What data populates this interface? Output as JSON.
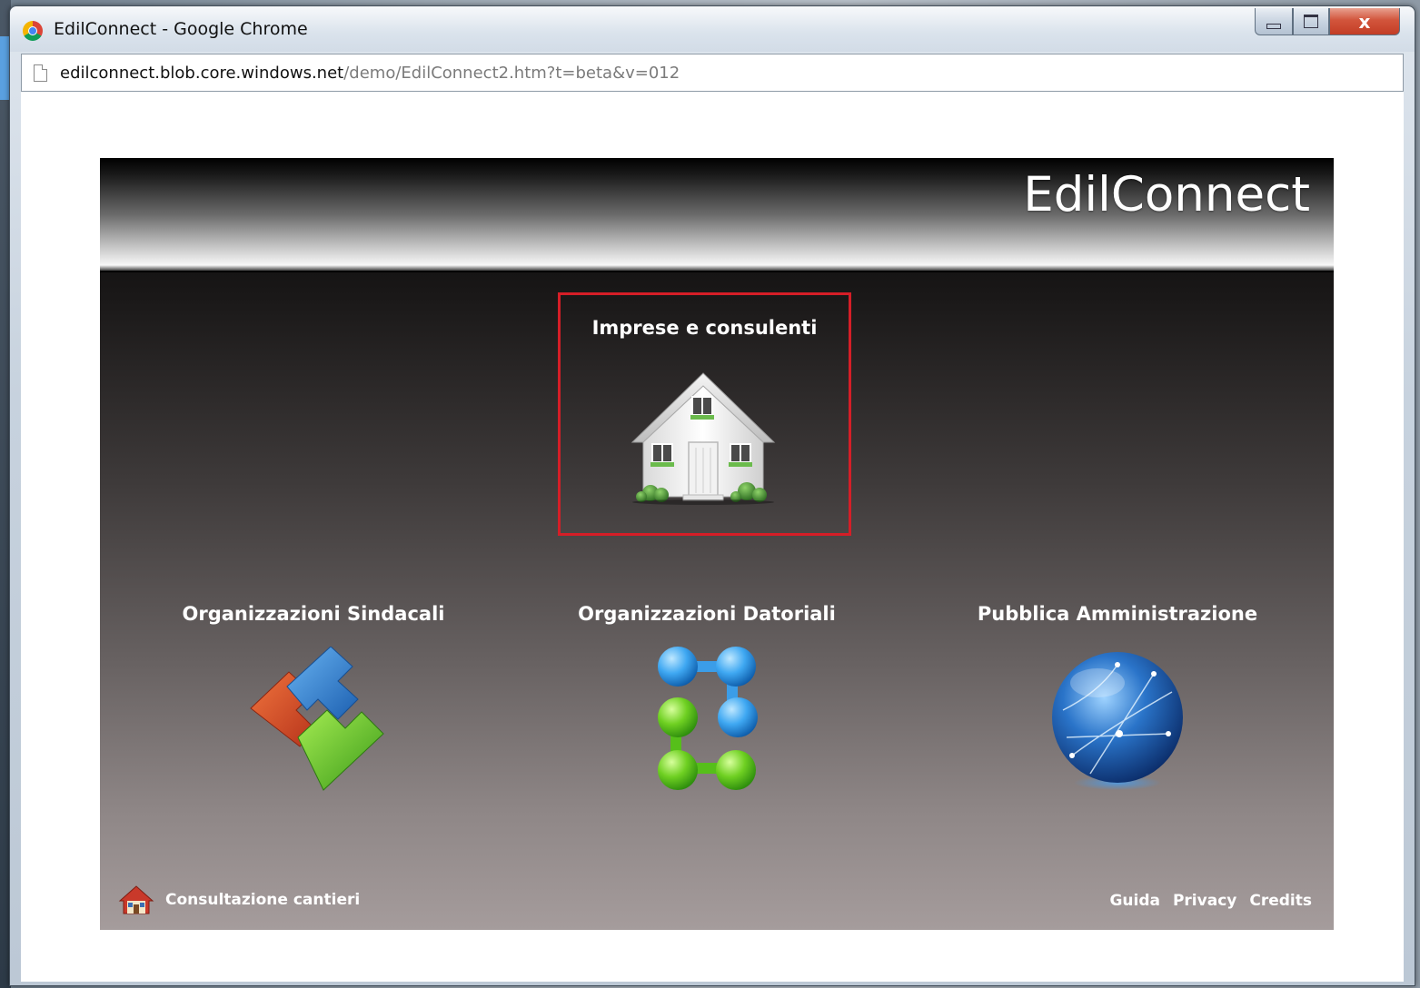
{
  "window": {
    "title": "EdilConnect - Google Chrome",
    "close_glyph": "x"
  },
  "address_bar": {
    "host": "edilconnect.blob.core.windows.net",
    "path": "/demo/EdilConnect2.htm?t=beta&v=012"
  },
  "app": {
    "title": "EdilConnect",
    "tiles": [
      {
        "label": "Imprese e consulenti",
        "icon": "house-icon",
        "selected": true
      },
      {
        "label": "Organizzazioni Sindacali",
        "icon": "puzzle-blocks-icon"
      },
      {
        "label": "Organizzazioni Datoriali",
        "icon": "molecule-icon"
      },
      {
        "label": "Pubblica Amministrazione",
        "icon": "globe-icon"
      }
    ],
    "footer": {
      "cantieri": "Consultazione cantieri",
      "links": [
        "Guida",
        "Privacy",
        "Credits"
      ]
    }
  },
  "colors": {
    "selection_border": "#d51e27"
  }
}
